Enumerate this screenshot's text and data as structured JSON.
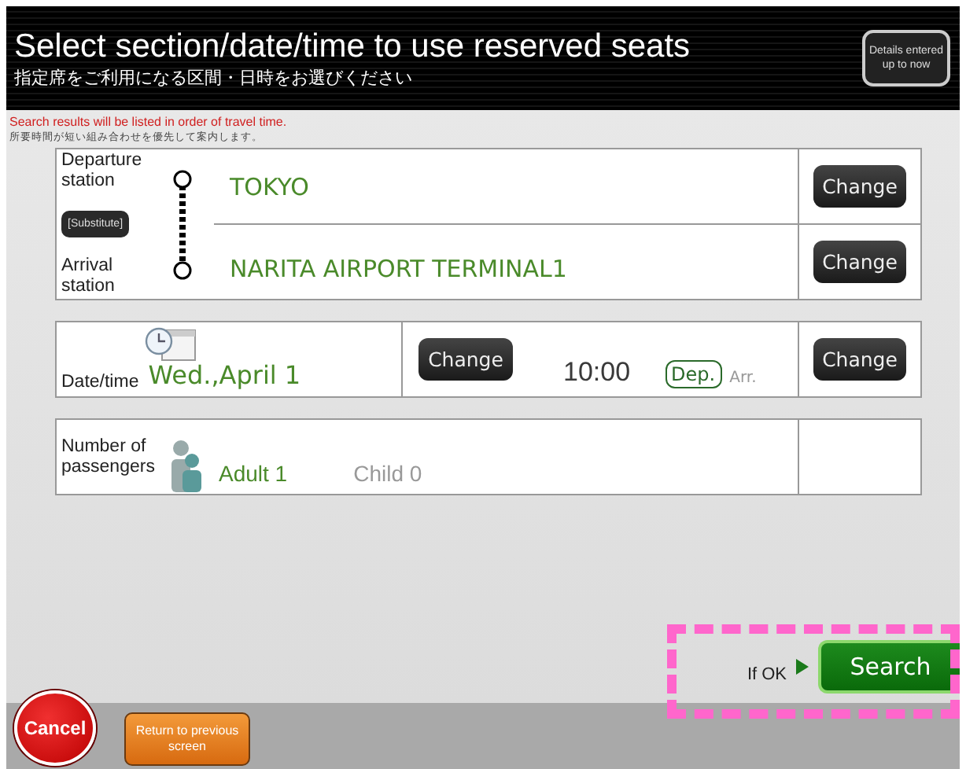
{
  "header": {
    "title": "Select section/date/time to use reserved seats",
    "subtitle": "指定席をご利用になる区間・日時をお選びください",
    "details_button": "Details entered up to now"
  },
  "notice": {
    "text": "Search results will be listed in order of travel time.",
    "text_jp": "所要時間が短い組み合わせを優先して案内します。"
  },
  "section": {
    "departure_label": "Departure station",
    "departure": "TOKYO",
    "arrival_label": "Arrival station",
    "arrival": "NARITA AIRPORT TERMINAL1",
    "substitute_button": "[Substitute]",
    "change_buttons": [
      "Change",
      "Change"
    ]
  },
  "datetime": {
    "label": "Date/time",
    "date": "Wed.,April 1",
    "date_change": "Change",
    "time": "10:00",
    "time_change": "Change",
    "modes": [
      {
        "label": "Dep.",
        "selected": true
      },
      {
        "label": "Arr.",
        "selected": false
      }
    ]
  },
  "passengers": {
    "label": "Number of passengers",
    "adult": "Adult 1",
    "child": "Child 0"
  },
  "footer": {
    "if_ok": "If OK",
    "search": "Search",
    "cancel": "Cancel",
    "return": "Return to previous screen"
  }
}
